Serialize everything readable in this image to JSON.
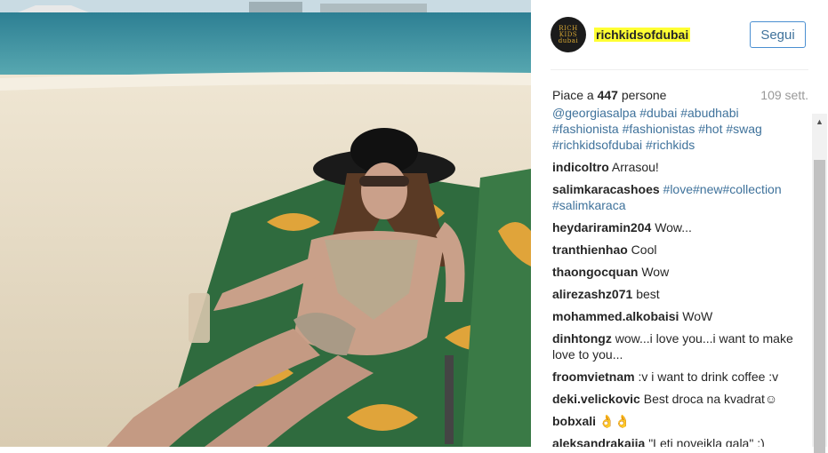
{
  "post": {
    "username": "richkidsofdubai",
    "avatar_text": "RICH KIDS dubai",
    "follow_label": "Segui",
    "likes_prefix": "Piace a ",
    "likes_count": "447",
    "likes_suffix": " persone",
    "time": "109 sett."
  },
  "comments": [
    {
      "user": "",
      "text": "@georgiasalpa #dubai #abudhabi #fashionista #fashionistas #hot #swag #richkidsofdubai #richkids",
      "tags": true
    },
    {
      "user": "indicoltro",
      "text": "Arrasou!",
      "tags": false
    },
    {
      "user": "salimkaracashoes",
      "text": "#love#new#collection #salimkaraca",
      "tags": true
    },
    {
      "user": "heydariramin204",
      "text": "Wow...",
      "tags": false
    },
    {
      "user": "tranthienhao",
      "text": "Cool",
      "tags": false
    },
    {
      "user": "thaongocquan",
      "text": "Wow",
      "tags": false
    },
    {
      "user": "alirezashz071",
      "text": "best",
      "tags": false
    },
    {
      "user": "mohammed.alkobaisi",
      "text": "WoW",
      "tags": false
    },
    {
      "user": "dinhtongz",
      "text": "wow...i love you...i want to make love to you...",
      "tags": false
    },
    {
      "user": "froomvietnam",
      "text": ":v i want to drink coffee :v",
      "tags": false
    },
    {
      "user": "deki.velickovic",
      "text": "Best droca na kvadrat☺",
      "tags": false
    },
    {
      "user": "bobxali",
      "text": "👌👌",
      "tags": false
    },
    {
      "user": "aleksandrakaija",
      "text": "\"Leti novejkla gala\" :)",
      "tags": false
    }
  ],
  "icons": {
    "scroll_up": "chevron-up-icon",
    "avatar": "brand-logo"
  }
}
